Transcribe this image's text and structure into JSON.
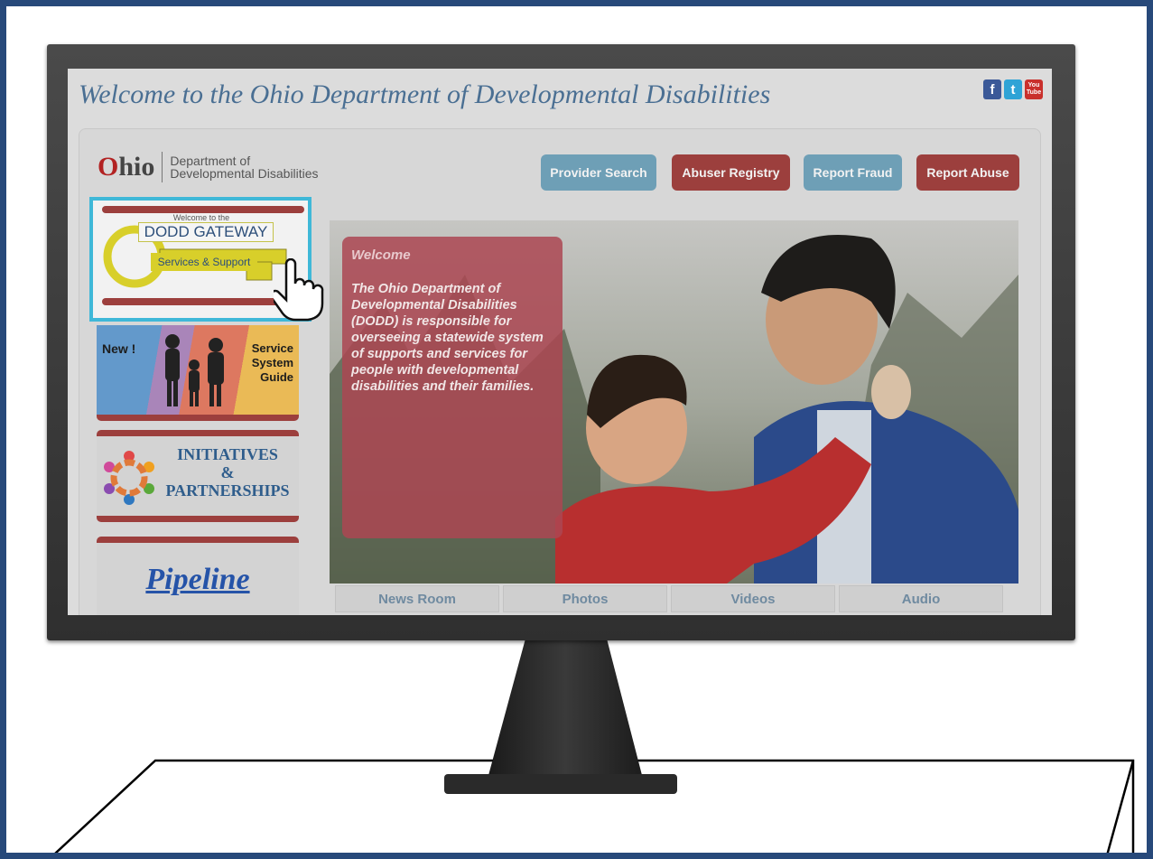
{
  "site": {
    "title": "Welcome to the Ohio Department of Developmental Disabilities",
    "social": [
      "facebook-icon",
      "twitter-icon",
      "youtube-icon"
    ],
    "youtube_label": "You Tube"
  },
  "logo": {
    "ohio_o": "O",
    "ohio_rest": "hio",
    "dept_line1": "Department of",
    "dept_line2": "Developmental Disabilities"
  },
  "top_buttons": {
    "provider_search": "Provider Search",
    "abuser_registry": "Abuser Registry",
    "report_fraud": "Report Fraud",
    "report_abuse": "Report Abuse"
  },
  "sidebar": {
    "gateway": {
      "kicker": "Welcome to the",
      "title": "DODD GATEWAY",
      "subtitle": "Services & Support"
    },
    "service_guide": {
      "new": "New !",
      "line1": "Service",
      "line2": "System",
      "line3": "Guide"
    },
    "initiatives": {
      "line1": "INITIATIVES",
      "line2": "&",
      "line3": "PARTNERSHIPS"
    },
    "pipeline": "Pipeline"
  },
  "hero": {
    "welcome_title": "Welcome",
    "welcome_text": "The  Ohio Department of\nDevelopmental Disabilities\n(DODD) is responsible for\noverseeing a statewide system\nof supports and services for\npeople with developmental\ndisabilities and their families."
  },
  "tabs": [
    "News Room",
    "Photos",
    "Videos",
    "Audio"
  ],
  "colors": {
    "frame_border": "#27497a",
    "highlight": "#3fb8d8",
    "accent_red": "#9c3f3d",
    "accent_blue": "#6e9fb6"
  }
}
